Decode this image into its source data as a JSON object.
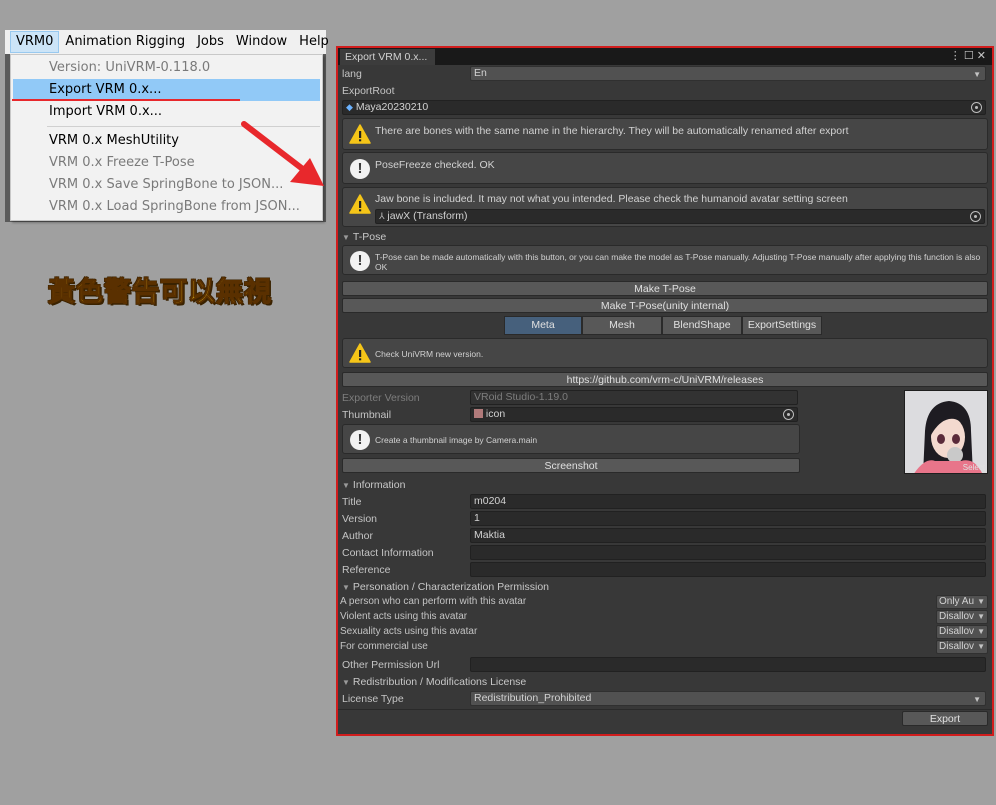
{
  "menubar": {
    "items": [
      "VRM0",
      "Animation Rigging",
      "Jobs",
      "Window",
      "Help"
    ]
  },
  "dropdown": {
    "version": "Version: UniVRM-0.118.0",
    "export": "Export VRM 0.x...",
    "import": "Import VRM 0.x...",
    "mesh_utility": "VRM 0.x MeshUtility",
    "freeze_tpose": "VRM 0.x Freeze T-Pose",
    "save_springbone": "VRM 0.x Save SpringBone to JSON...",
    "load_springbone": "VRM 0.x Load SpringBone from JSON..."
  },
  "annotation": "黃色警告可以無視",
  "window": {
    "tab_title": "Export VRM 0.x...",
    "lang_label": "lang",
    "lang_value": "En",
    "export_root_label": "ExportRoot",
    "export_root_value": "Maya20230210",
    "warn_bones": "There are bones with the same name in the hierarchy. They will be automatically renamed after export",
    "info_posefreeze": "PoseFreeze checked. OK",
    "warn_jaw": "Jaw bone is included. It may not what you intended. Please check the humanoid avatar setting screen",
    "jaw_object": "jawX (Transform)",
    "tpose_section": "T-Pose",
    "tpose_info": "T-Pose can be made automatically with this button, or you can make the model as T-Pose manually. Adjusting T-Pose manually after applying this function is also OK",
    "make_tpose": "Make T-Pose",
    "make_tpose_internal": "Make T-Pose(unity internal)",
    "tabs": [
      "Meta",
      "Mesh",
      "BlendShape",
      "ExportSettings"
    ],
    "check_new_version": "Check UniVRM new version.",
    "releases_url": "https://github.com/vrm-c/UniVRM/releases",
    "exporter_version_label": "Exporter Version",
    "exporter_version_value": "VRoid Studio-1.19.0",
    "thumbnail_label": "Thumbnail",
    "thumbnail_value": "icon",
    "thumbnail_info": "Create a thumbnail image by Camera.main",
    "screenshot_button": "Screenshot",
    "thumb_select": "Select",
    "information_section": "Information",
    "title_label": "Title",
    "title_value": "m0204",
    "version_label": "Version",
    "version_value": "1",
    "author_label": "Author",
    "author_value": "Maktia",
    "contact_label": "Contact Information",
    "contact_value": "",
    "reference_label": "Reference",
    "reference_value": "",
    "personation_section": "Personation / Characterization Permission",
    "perm_perform_label": "A person who can perform with this avatar",
    "perm_perform_value": "Only Au",
    "perm_violent_label": "Violent acts using this avatar",
    "perm_violent_value": "Disallov",
    "perm_sexual_label": "Sexuality acts using this avatar",
    "perm_sexual_value": "Disallov",
    "perm_commercial_label": "For commercial use",
    "perm_commercial_value": "Disallov",
    "other_permission_label": "Other Permission Url",
    "other_permission_value": "",
    "redistribution_section": "Redistribution / Modifications License",
    "license_type_label": "License Type",
    "license_type_value": "Redistribution_Prohibited",
    "export_button": "Export"
  },
  "colors": {
    "window_bg": "#383838",
    "window_border": "#d11d1d",
    "highlight": "#91c9f7",
    "warning": "#f5c518",
    "annotation_text": "#ffd21f",
    "active_tab": "#46607c"
  }
}
